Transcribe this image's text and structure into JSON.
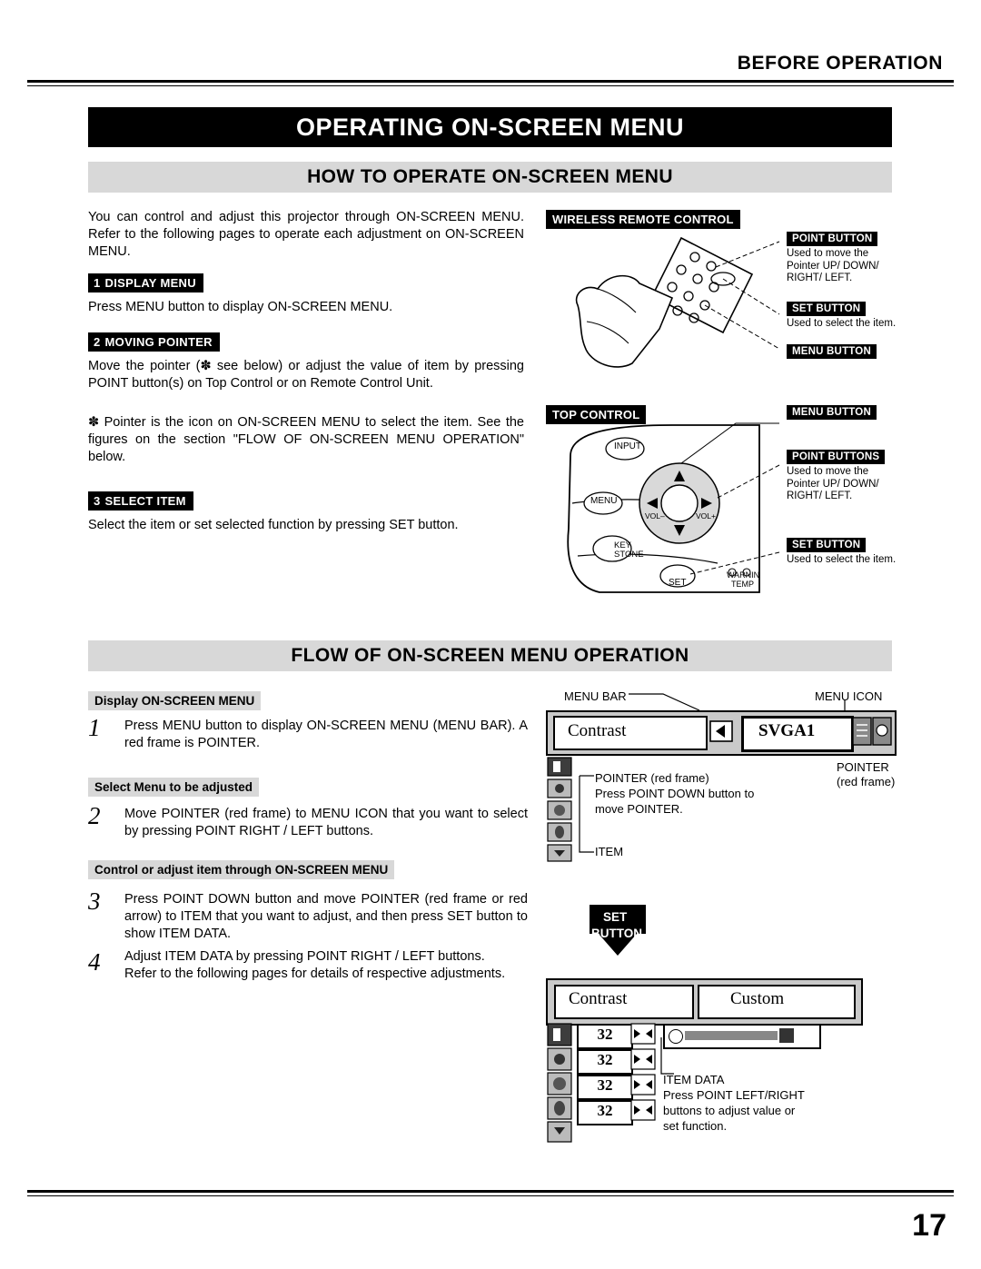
{
  "header": {
    "running_head": "BEFORE OPERATION",
    "page_number": "17"
  },
  "title_bar": "OPERATING ON-SCREEN MENU",
  "sections": [
    {
      "id": "how-to-operate",
      "heading": "HOW TO OPERATE ON-SCREEN MENU"
    },
    {
      "id": "flow",
      "heading": "FLOW OF ON-SCREEN MENU OPERATION"
    }
  ],
  "how_to_operate": {
    "intro": "You can control and adjust this projector through ON-SCREEN MENU.  Refer to the following pages to operate each adjustment on ON-SCREEN MENU.",
    "steps": [
      {
        "num": "1",
        "label": "DISPLAY MENU",
        "body": "Press MENU button to display ON-SCREEN MENU."
      },
      {
        "num": "2",
        "label": "MOVING POINTER",
        "body": "Move the pointer (✽ see below) or adjust the value of item by pressing POINT button(s) on Top Control or on Remote Control Unit.",
        "note": "✽  Pointer is the icon on ON-SCREEN MENU to select the item. See the figures on the section \"FLOW OF ON-SCREEN MENU OPERATION\" below."
      },
      {
        "num": "3",
        "label": "SELECT ITEM",
        "body": "Select the item or set selected function by pressing SET button."
      }
    ]
  },
  "remote_figure": {
    "title": "WIRELESS REMOTE CONTROL",
    "callouts": [
      {
        "label": "POINT BUTTON",
        "text": "Used to move the\nPointer UP/ DOWN/\nRIGHT/ LEFT."
      },
      {
        "label": "SET BUTTON",
        "text": "Used to select the item."
      },
      {
        "label": "MENU BUTTON",
        "text": ""
      }
    ]
  },
  "top_control_figure": {
    "title": "TOP CONTROL",
    "callouts": [
      {
        "label": "MENU BUTTON",
        "text": ""
      },
      {
        "label": "POINT BUTTONS",
        "text": "Used to move the\nPointer UP/ DOWN/\nRIGHT/ LEFT."
      },
      {
        "label": "SET BUTTON",
        "text": "Used to select the item."
      }
    ],
    "button_labels": [
      "INPUT",
      "MENU",
      "KEY STONE",
      "SET",
      "VOL–",
      "VOL+",
      "WARNING TEMP."
    ]
  },
  "flow": {
    "steps": [
      {
        "num": "1",
        "label": "Display ON-SCREEN MENU",
        "body": "Press MENU button to display ON-SCREEN MENU (MENU BAR).  A red frame is POINTER."
      },
      {
        "num": "2",
        "label": "Select Menu to be adjusted",
        "body": "Move POINTER (red frame) to MENU ICON that you want to select by pressing POINT RIGHT / LEFT buttons."
      },
      {
        "num": "3",
        "label": "Control or adjust item through ON-SCREEN MENU",
        "body": "Press POINT DOWN button and move POINTER (red frame or red arrow) to ITEM that you want to adjust, and then press SET button to show ITEM DATA."
      },
      {
        "num": "4",
        "label": "",
        "body": "Adjust ITEM DATA by pressing POINT RIGHT / LEFT buttons.\nRefer to the following pages for details of respective adjustments."
      }
    ],
    "diagram1": {
      "menu_bar_label": "MENU BAR",
      "menu_icon_label": "MENU ICON",
      "pointer_label": "POINTER",
      "pointer_sub": "(red frame)",
      "menu_title": "Contrast",
      "source_value": "SVGA1",
      "pointer_note_title": "POINTER (red frame)",
      "pointer_note": "Press POINT DOWN button to\nmove POINTER.",
      "item_label": "ITEM"
    },
    "diagram2": {
      "set_button_label_line1": "SET",
      "set_button_label_line2": "BUTTON",
      "menu_title": "Contrast",
      "custom_label": "Custom",
      "values": [
        "32",
        "32",
        "32",
        "32"
      ],
      "item_data_label": "ITEM DATA",
      "item_data_note": "Press  POINT  LEFT/RIGHT\nbuttons  to  adjust  value  or\nset function."
    }
  }
}
